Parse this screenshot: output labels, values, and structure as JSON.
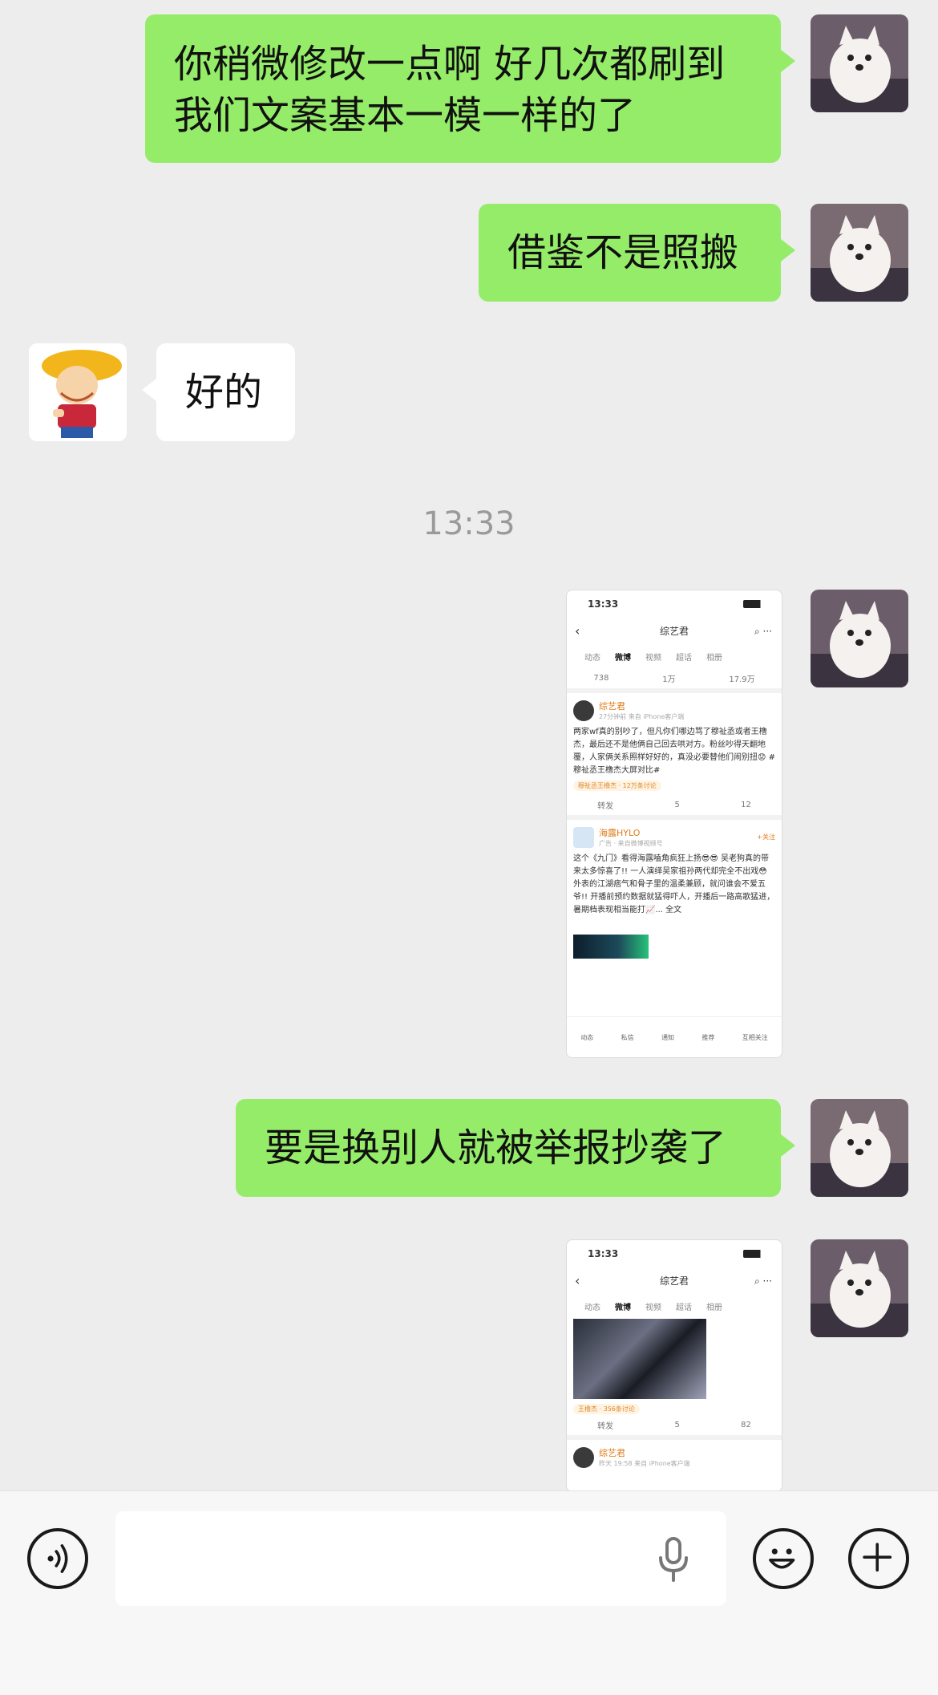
{
  "messages": [
    {
      "id": "m1",
      "side": "me",
      "text_lines": [
        "你稍微修改一点啊 好几次都刷到",
        "我们文案基本一模一样的了"
      ]
    },
    {
      "id": "m2",
      "side": "me",
      "text": "借鉴不是照搬"
    },
    {
      "id": "m3",
      "side": "other",
      "text": "好的"
    },
    {
      "id": "m4",
      "side": "me",
      "text": "要是换别人就被举报抄袭了"
    }
  ],
  "timestamp": "13:33",
  "screenshot1": {
    "time": "13:33",
    "nav_title": "综艺君",
    "tabs": [
      "动态",
      "微博",
      "视频",
      "超话",
      "相册"
    ],
    "stats": [
      "738",
      "1万",
      "17.9万"
    ],
    "post1": {
      "author": "综艺君",
      "meta": "27分钟前 来自 iPhone客户端",
      "text": "两家wf真的别吵了，但凡你们哪边骂了穆祉丞或者王橹杰，最后还不是他俩自己回去哄对方。粉丝吵得天翻地覆，人家俩关系照样好好的，真没必要替他们闹别扭😟 #穆祉丞王橹杰大屏对比#",
      "topic": "穆祉丞王橹杰 · 12万条讨论",
      "repost": "转发",
      "comments": "5",
      "likes": "12"
    },
    "post2": {
      "author": "海露HYLO",
      "meta": "广告 · 来自微博视频号",
      "follow": "+关注",
      "text": "这个《九门》看得海露嗑角疯狂上扬😎😎 吴老狗真的带来太多惊喜了!! 一人演绎吴家祖孙两代却完全不出戏😳 外表的江湖痞气和骨子里的温柔兼顾，就问谁会不爱五爷!! 开播前预约数据就猛得吓人，开播后一路高歌猛进，暑期档表现相当能打📈... 全文"
    },
    "tabbar": [
      "动态",
      "私信",
      "通知",
      "推荐",
      "互相关注"
    ]
  },
  "screenshot2": {
    "time": "13:33",
    "nav_title": "综艺君",
    "tabs": [
      "动态",
      "微博",
      "视频",
      "超话",
      "相册"
    ],
    "topic": "王橹杰 · 356条讨论",
    "repost": "转发",
    "comments": "5",
    "likes": "82",
    "author": "综艺君",
    "meta": "昨天 19:58 来自 iPhone客户端"
  },
  "icons": {
    "voice": "voice-icon",
    "emoji": "emoji-icon",
    "plus": "plus-icon",
    "mic": "mic-icon"
  },
  "colors": {
    "my_bubble": "#95ec69",
    "other_bubble": "#ffffff",
    "background": "#ededed"
  }
}
